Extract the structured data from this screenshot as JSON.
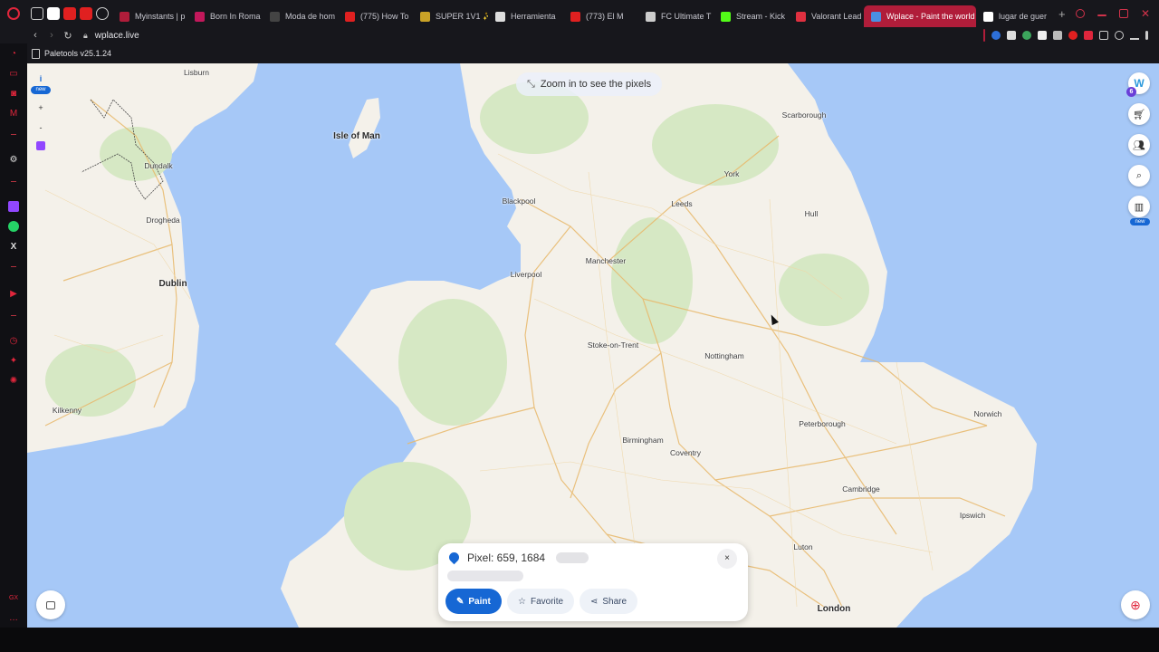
{
  "browser": {
    "tabs": [
      {
        "label": "Myinstants | p",
        "icon_color": "#b01d3a"
      },
      {
        "label": "Born In Roma",
        "icon_color": "#c2185b"
      },
      {
        "label": "Moda de hom",
        "icon_color": "#444444"
      },
      {
        "label": "(775) How To",
        "icon_color": "#e02020"
      },
      {
        "label": "SUPER 1V1 ✨",
        "icon_color": "#c9a227"
      },
      {
        "label": "Herramienta",
        "icon_color": "#dddddd"
      },
      {
        "label": "(773) El M",
        "icon_color": "#e02020"
      },
      {
        "label": "FC Ultimate T",
        "icon_color": "#cccccc"
      },
      {
        "label": "Stream - Kick",
        "icon_color": "#53fc18"
      },
      {
        "label": "Valorant Lead",
        "icon_color": "#e03040"
      },
      {
        "label": "Wplace - Paint the world",
        "icon_color": "#4a90e2",
        "active": true
      },
      {
        "label": "lugar de guer",
        "icon_color": "#ffffff"
      }
    ],
    "url": "wplace.live",
    "bookmark": "Paletools v25.1.24",
    "accent": "#b01d3a"
  },
  "map": {
    "zoom_hint": "Zoom in to see the pixels",
    "info_label": "i",
    "new_badge": "new",
    "zoom_in": "+",
    "zoom_out": "-",
    "logo_letter": "W",
    "logo_badge": "6",
    "right_new_badge": "new",
    "cities": [
      {
        "name": "Lisburn",
        "cls": ""
      },
      {
        "name": "Isle of Man",
        "cls": "big"
      },
      {
        "name": "Dundalk",
        "cls": ""
      },
      {
        "name": "Drogheda",
        "cls": ""
      },
      {
        "name": "Dublin",
        "cls": "big"
      },
      {
        "name": "Kilkenny",
        "cls": ""
      },
      {
        "name": "Scarborough",
        "cls": ""
      },
      {
        "name": "York",
        "cls": ""
      },
      {
        "name": "Leeds",
        "cls": ""
      },
      {
        "name": "Blackpool",
        "cls": ""
      },
      {
        "name": "Hull",
        "cls": ""
      },
      {
        "name": "Manchester",
        "cls": ""
      },
      {
        "name": "Liverpool",
        "cls": ""
      },
      {
        "name": "Stoke-on-Trent",
        "cls": ""
      },
      {
        "name": "Nottingham",
        "cls": ""
      },
      {
        "name": "Norwich",
        "cls": ""
      },
      {
        "name": "Peterborough",
        "cls": ""
      },
      {
        "name": "Birmingham",
        "cls": ""
      },
      {
        "name": "Coventry",
        "cls": ""
      },
      {
        "name": "Cambridge",
        "cls": ""
      },
      {
        "name": "Ipswich",
        "cls": ""
      },
      {
        "name": "Luton",
        "cls": ""
      },
      {
        "name": "London",
        "cls": "big"
      }
    ],
    "colors": {
      "sea": "#a6c8f7",
      "land": "#f4f1ea",
      "green": "#d6e8c4",
      "road": "#e8b86a"
    }
  },
  "pixel_panel": {
    "title": "Pixel: 659, 1684",
    "close": "×",
    "paint_label": "Paint",
    "favorite_label": "Favorite",
    "share_label": "Share"
  }
}
